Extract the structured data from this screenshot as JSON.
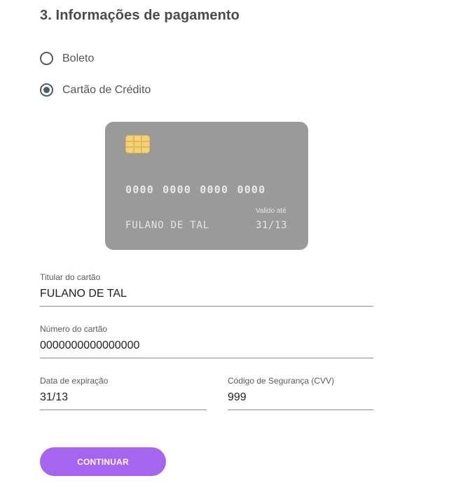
{
  "section": {
    "title": "3. Informações de pagamento"
  },
  "payment_methods": [
    {
      "label": "Boleto",
      "selected": false
    },
    {
      "label": "Cartão de Crédito",
      "selected": true
    }
  ],
  "card_preview": {
    "number": "0000 0000 0000 0000",
    "holder": "FULANO DE TAL",
    "valid_label": "Valido até",
    "valid_value": "31/13",
    "background_color": "#9a9a9a",
    "chip_icon": "card-chip-icon"
  },
  "form": {
    "holder": {
      "label": "Titular do cartão",
      "value": "FULANO DE TAL"
    },
    "number": {
      "label": "Número do cartão",
      "value": "0000000000000000"
    },
    "expiry": {
      "label": "Data de expiração",
      "value": "31/13"
    },
    "cvv": {
      "label": "Código de Segurança (CVV)",
      "value": "999"
    }
  },
  "actions": {
    "continue_label": "CONTINUAR",
    "continue_color": "#a565f1"
  }
}
